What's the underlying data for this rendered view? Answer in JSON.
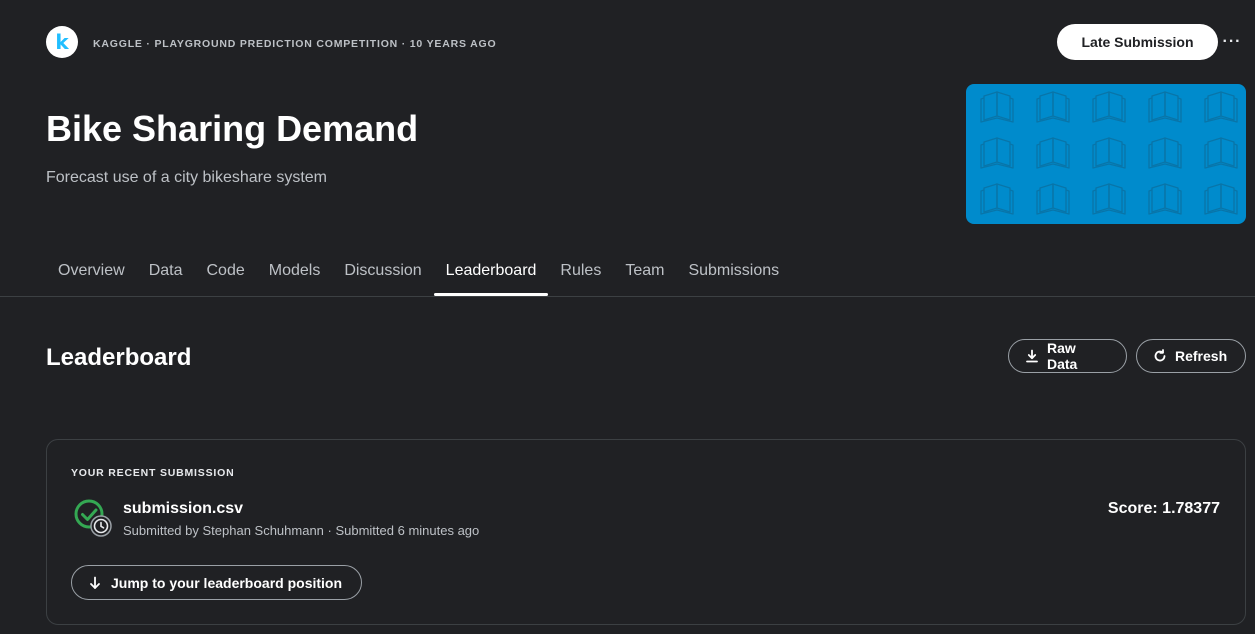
{
  "header": {
    "logo_letter": "k",
    "meta": "KAGGLE · PLAYGROUND PREDICTION COMPETITION · 10 YEARS AGO",
    "late_submission_label": "Late Submission",
    "more_label": "···"
  },
  "competition": {
    "title": "Bike Sharing Demand",
    "subtitle": "Forecast use of a city bikeshare system",
    "banner_color": "#008bcc"
  },
  "tabs": [
    {
      "label": "Overview"
    },
    {
      "label": "Data"
    },
    {
      "label": "Code"
    },
    {
      "label": "Models"
    },
    {
      "label": "Discussion"
    },
    {
      "label": "Leaderboard",
      "active": true
    },
    {
      "label": "Rules"
    },
    {
      "label": "Team"
    },
    {
      "label": "Submissions"
    }
  ],
  "leaderboard": {
    "title": "Leaderboard",
    "raw_data_label": "Raw Data",
    "raw_data_icon": "download-icon",
    "refresh_label": "Refresh",
    "refresh_icon": "refresh-icon"
  },
  "recent_submission": {
    "section_label": "YOUR RECENT SUBMISSION",
    "file_name": "submission.csv",
    "meta": "Submitted by Stephan Schuhmann · Submitted 6 minutes ago",
    "score": "Score: 1.78377",
    "status_icon": "check-clock-icon",
    "status_color": "#34a853",
    "jump_label": "Jump to your leaderboard position",
    "jump_icon": "arrow-down-icon"
  },
  "colors": {
    "background": "#202124",
    "accent": "#20beff"
  }
}
